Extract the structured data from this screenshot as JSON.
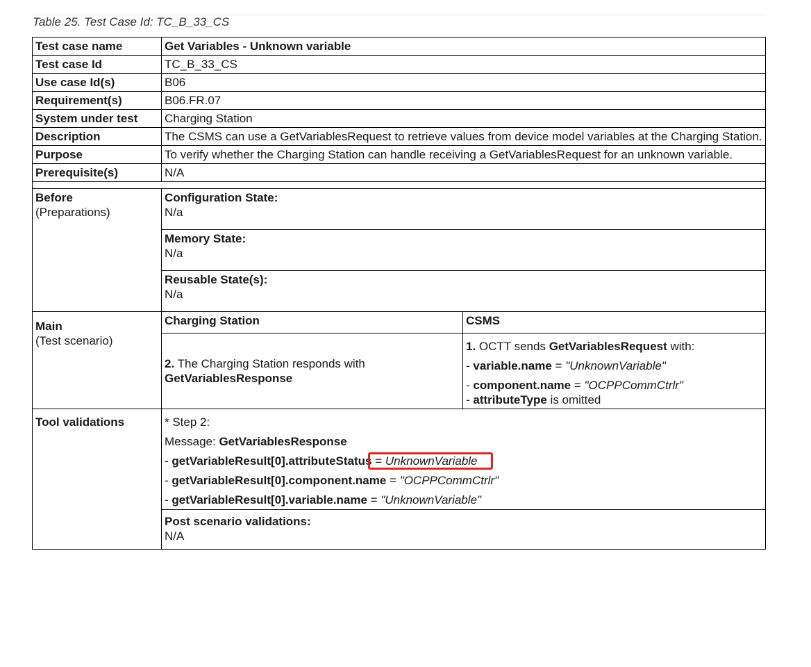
{
  "caption": "Table 25. Test Case Id: TC_B_33_CS",
  "rows": {
    "name": {
      "label": "Test case name",
      "value": "Get Variables - Unknown variable"
    },
    "id": {
      "label": "Test case Id",
      "value": "TC_B_33_CS"
    },
    "usecase": {
      "label": "Use case Id(s)",
      "value": "B06"
    },
    "req": {
      "label": "Requirement(s)",
      "value": "B06.FR.07"
    },
    "sut": {
      "label": "System under test",
      "value": "Charging Station"
    },
    "desc": {
      "label": "Description",
      "value": "The CSMS can use a GetVariablesRequest to retrieve values from device model variables at the Charging Station."
    },
    "purpose": {
      "label": "Purpose",
      "value": "To verify whether the Charging Station can handle receiving a GetVariablesRequest for an unknown variable."
    },
    "prereq": {
      "label": "Prerequisite(s)",
      "value": "N/A"
    }
  },
  "before": {
    "label": "Before",
    "sublabel": "(Preparations)",
    "config_title": "Configuration State:",
    "config_value": "N/a",
    "memory_title": "Memory State:",
    "memory_value": "N/a",
    "reusable_title": "Reusable State(s):",
    "reusable_value": "N/a"
  },
  "main": {
    "label": "Main",
    "sublabel": "(Test scenario)",
    "col_cs": "Charging Station",
    "col_csms": "CSMS",
    "cs_step_num": "2.",
    "cs_step_text": " The Charging Station responds with",
    "cs_step_msg": "GetVariablesResponse",
    "csms_step_num": "1.",
    "csms_step_text1": " OCTT sends ",
    "csms_step_msg": "GetVariablesRequest",
    "csms_step_text2": " with:",
    "csms_l1_prefix": "- ",
    "csms_l1_key": "variable.name",
    "csms_l1_eq": " = ",
    "csms_l1_val": "\"UnknownVariable\"",
    "csms_l2_prefix": "- ",
    "csms_l2_key": "component.name",
    "csms_l2_eq": " = ",
    "csms_l2_val": "\"OCPPCommCtrlr\"",
    "csms_l3_prefix": "- ",
    "csms_l3_key": "attributeType",
    "csms_l3_rest": " is omitted"
  },
  "tool": {
    "label": "Tool validations",
    "step": "* Step 2:",
    "msg_prefix": "Message: ",
    "msg": "GetVariablesResponse",
    "l1_prefix": "- ",
    "l1_key": "getVariableResult[0].attributeStatus",
    "l1_eq": " = ",
    "l1_val": "UnknownVariable",
    "l2_prefix": "- ",
    "l2_key": "getVariableResult[0].component.name",
    "l2_eq": " = ",
    "l2_val": "\"OCPPCommCtrlr\"",
    "l3_prefix": "- ",
    "l3_key": "getVariableResult[0].variable.name",
    "l3_eq": " = ",
    "l3_val": "\"UnknownVariable\"",
    "post_title": "Post scenario validations:",
    "post_value": "N/A"
  },
  "highlight_color": "#e02424"
}
